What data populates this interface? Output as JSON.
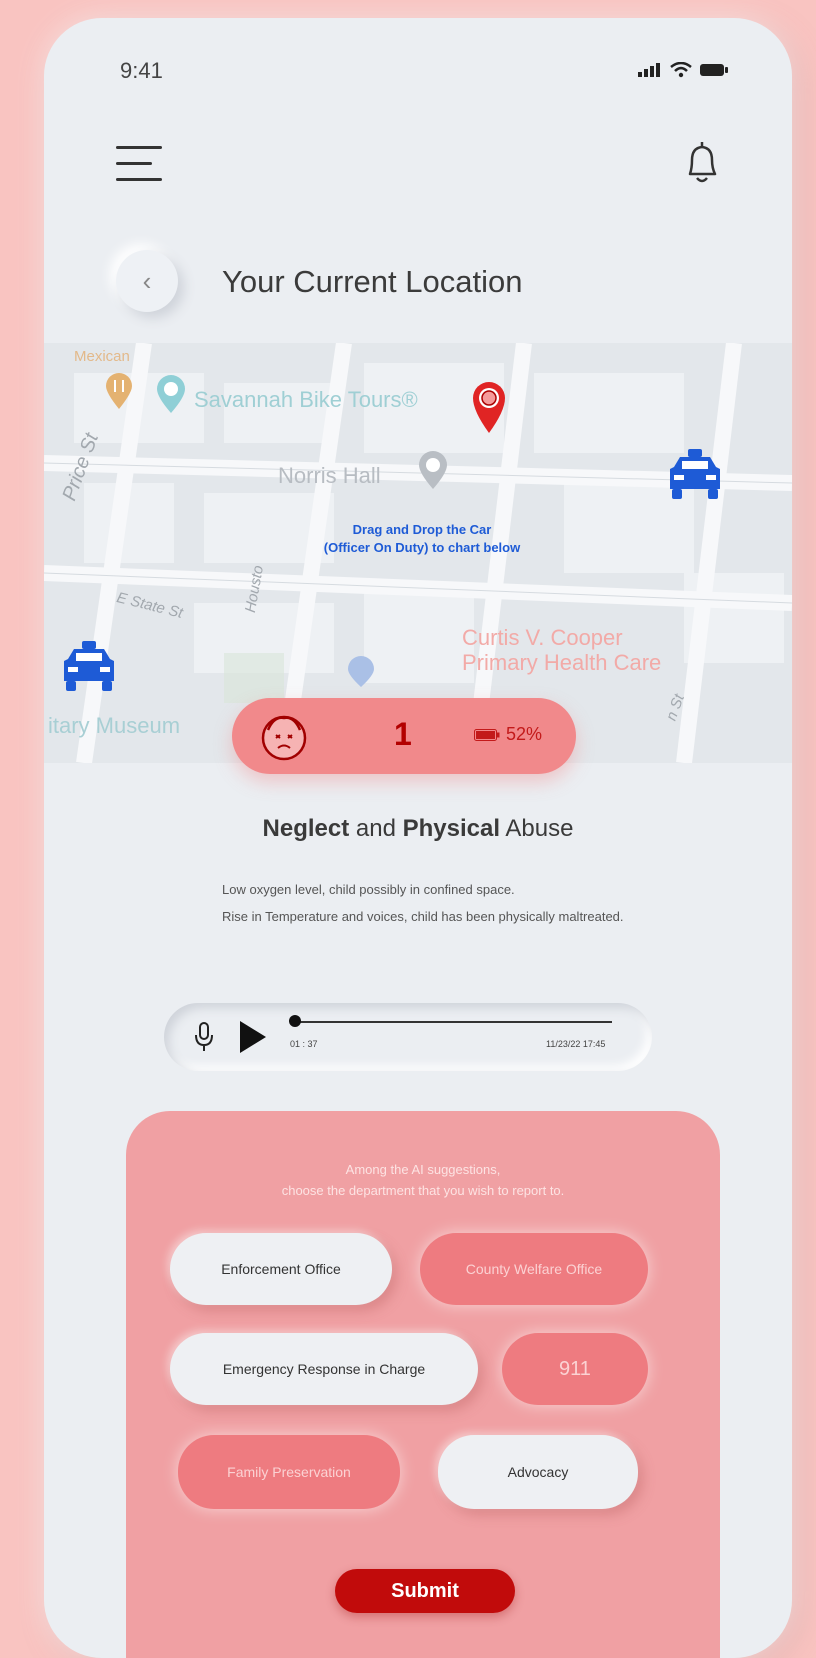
{
  "status_bar": {
    "time": "9:41"
  },
  "header": {
    "title": "Your Current Location"
  },
  "map": {
    "labels": {
      "mexican": "Mexican",
      "bike_tours": "Savannah Bike Tours®",
      "norris_hall": "Norris Hall",
      "price_st": "Price St",
      "e_state_st": "E State St",
      "houston": "Housto",
      "curtis_1": "Curtis V. Cooper",
      "curtis_2": "Primary Health Care",
      "museum": "itary Museum",
      "st_fragment": "n St"
    },
    "drag_note_1": "Drag and Drop the Car",
    "drag_note_2": "(Officer On Duty) to chart below"
  },
  "alert": {
    "count": "1",
    "battery": "52%"
  },
  "case": {
    "title_part1": "Neglect",
    "title_part2": " and ",
    "title_part3": "Physical",
    "title_part4": " Abuse",
    "line1": "Low oxygen level, child possibly in confined space.",
    "line2": "Rise in Temperature and voices, child has been physically maltreated."
  },
  "audio": {
    "elapsed": "01 : 37",
    "timestamp": "11/23/22 17:45",
    "progress": 0
  },
  "report": {
    "prompt_1": "Among the AI suggestions,",
    "prompt_2": "choose the department that you wish to report to.",
    "options": {
      "enforcement": "Enforcement Office",
      "county": "County Welfare Office",
      "emergency": "Emergency Response in Charge",
      "nine11": "911",
      "family": "Family Preservation",
      "advocacy": "Advocacy"
    },
    "submit": "Submit"
  },
  "colors": {
    "accent": "#f1898b",
    "submit": "#c10b0b",
    "car": "#1e5bd6"
  }
}
